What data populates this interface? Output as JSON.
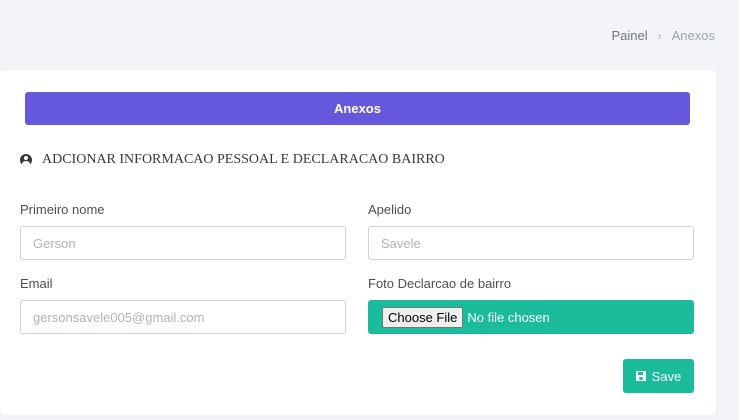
{
  "breadcrumb": {
    "items": [
      "Painel",
      "Anexos"
    ],
    "separator": "›"
  },
  "card": {
    "header_label": "Anexos",
    "section_title": "ADCIONAR INFORMACAO PESSOAL E DECLARACAO BAIRRO",
    "section_icon": "user-circle-icon"
  },
  "form": {
    "first_name": {
      "label": "Primeiro nome",
      "placeholder": "Gerson"
    },
    "surname": {
      "label": "Apelido",
      "placeholder": "Savele"
    },
    "email": {
      "label": "Email",
      "placeholder": "gersonsavele005@gmail.com"
    },
    "photo": {
      "label": "Foto Declarcao de bairro",
      "button_label": "Choose File",
      "status": "No file chosen"
    },
    "save_label": "Save",
    "save_icon": "floppy-disk-icon"
  },
  "colors": {
    "accent": "#6658dd",
    "success": "#1abc9c",
    "background": "#f3f4f7"
  }
}
